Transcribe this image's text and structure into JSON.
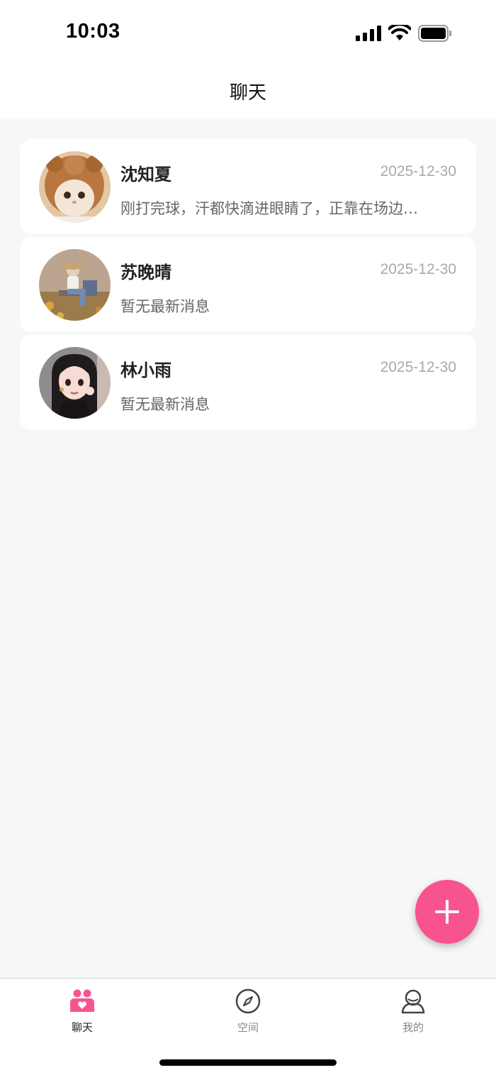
{
  "status_bar": {
    "time": "10:03",
    "icons": [
      "signal-icon",
      "wifi-icon",
      "battery-icon"
    ]
  },
  "header": {
    "title": "聊天"
  },
  "chats": [
    {
      "name": "沈知夏",
      "date": "2025-12-30",
      "preview": "刚打完球，汗都快滴进眼睛了，正靠在场边…",
      "avatar": "cat-avatar"
    },
    {
      "name": "苏晚晴",
      "date": "2025-12-30",
      "preview": "暂无最新消息",
      "avatar": "autumn-girl-avatar"
    },
    {
      "name": "林小雨",
      "date": "2025-12-30",
      "preview": "暂无最新消息",
      "avatar": "anime-girl-avatar"
    }
  ],
  "fab": {
    "icon": "plus-icon"
  },
  "tabbar": {
    "tabs": [
      {
        "label": "聊天",
        "icon": "chat-users-icon",
        "active": true
      },
      {
        "label": "空间",
        "icon": "compass-icon",
        "active": false
      },
      {
        "label": "我的",
        "icon": "profile-icon",
        "active": false
      }
    ]
  },
  "colors": {
    "accent": "#f7548f",
    "background": "#f7f7f7",
    "card": "#ffffff",
    "date_text": "#a9a9a9"
  }
}
